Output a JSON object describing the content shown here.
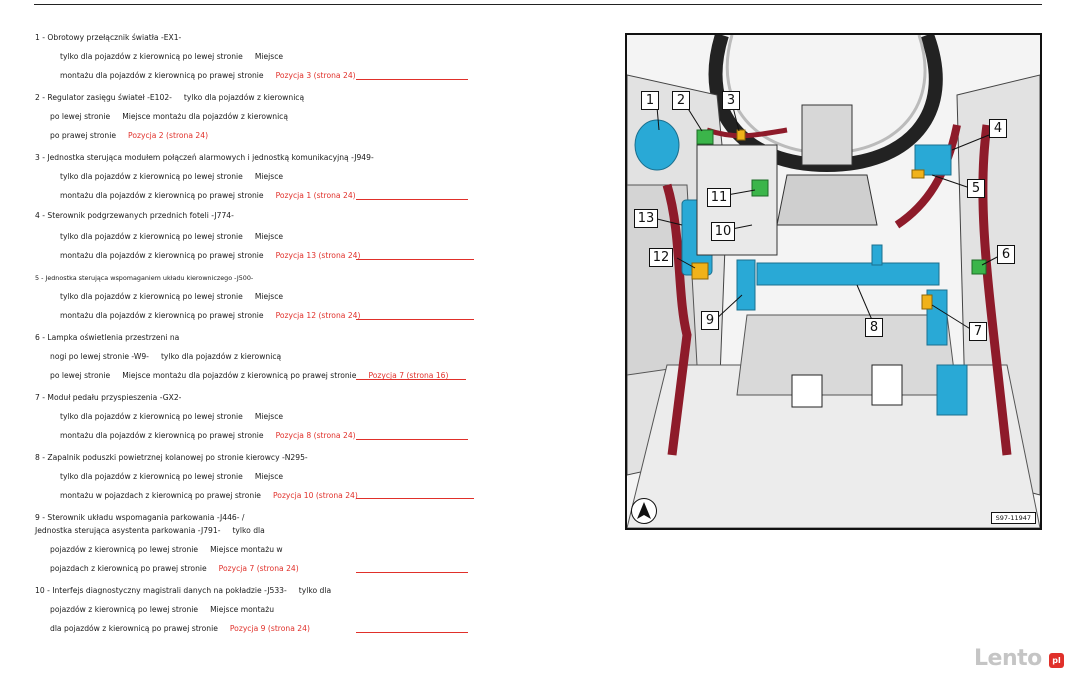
{
  "items": [
    {
      "lines": [
        {
          "parts": [
            {
              "t": "1 - Obrotowy przełącznik światła -EX1-"
            }
          ]
        },
        {
          "parts": [
            {
              "t": "tylko dla pojazdów z kierownicą po lewej stronie"
            },
            {
              "t": "Miejsce"
            }
          ]
        },
        {
          "parts": [
            {
              "t": "montażu dla pojazdów z kierownicą po prawej stronie"
            },
            {
              "t": "Pozycja 3 (strona 24)",
              "red": true
            }
          ]
        }
      ]
    },
    {
      "lines": [
        {
          "parts": [
            {
              "t": "2 - Regulator zasięgu świateł -E102-"
            },
            {
              "t": "tylko dla pojazdów z kierownicą"
            }
          ]
        },
        {
          "parts": [
            {
              "t": "po lewej stronie"
            },
            {
              "t": "Miejsce montażu dla pojazdów z kierownicą"
            }
          ]
        },
        {
          "parts": [
            {
              "t": "po prawej stronie"
            },
            {
              "t": "Pozycja 2 (strona 24)",
              "red": true
            }
          ]
        }
      ]
    },
    {
      "lines": [
        {
          "parts": [
            {
              "t": "3 - Jednostka sterująca modułem połączeń alarmowych i jednostką komunikacyjną -J949-"
            }
          ]
        },
        {
          "parts": [
            {
              "t": "tylko dla pojazdów z kierownicą po lewej stronie"
            },
            {
              "t": "Miejsce"
            }
          ]
        },
        {
          "parts": [
            {
              "t": "montażu dla pojazdów z kierownicą po prawej stronie"
            },
            {
              "t": "Pozycja 1 (strona 24)",
              "red": true
            }
          ]
        }
      ]
    },
    {
      "lines": [
        {
          "parts": [
            {
              "t": "4 - Sterownik podgrzewanych przednich foteli -J774-"
            }
          ]
        },
        {
          "parts": [
            {
              "t": "tylko dla pojazdów z kierownicą po lewej stronie"
            },
            {
              "t": "Miejsce"
            }
          ]
        },
        {
          "parts": [
            {
              "t": "montażu dla pojazdów z kierownicą po prawej stronie"
            },
            {
              "t": "Pozycja 13 (strona 24)",
              "red": true
            }
          ]
        }
      ]
    },
    {
      "lines": [
        {
          "parts": [
            {
              "t": "5 - Jednostka sterująca wspomaganiem układu kierowniczego -J500-"
            }
          ]
        },
        {
          "parts": [
            {
              "t": "tylko dla pojazdów z kierownicą po lewej stronie"
            },
            {
              "t": "Miejsce"
            }
          ]
        },
        {
          "parts": [
            {
              "t": "montażu dla pojazdów z kierownicą po prawej stronie"
            },
            {
              "t": "Pozycja 12 (strona 24)",
              "red": true
            }
          ]
        }
      ]
    },
    {
      "lines": [
        {
          "parts": [
            {
              "t": "6 - Lampka oświetlenia przestrzeni na"
            }
          ]
        },
        {
          "parts": [
            {
              "t": "nogi po lewej stronie -W9-"
            },
            {
              "t": "tylko dla pojazdów z kierownicą"
            }
          ]
        },
        {
          "parts": [
            {
              "t": "po lewej stronie"
            },
            {
              "t": "Miejsce montażu dla pojazdów z kierownicą po prawej stronie"
            },
            {
              "t": "Pozycja 7 (strona 16)",
              "red": true
            }
          ]
        }
      ]
    },
    {
      "lines": [
        {
          "parts": [
            {
              "t": "7 - Moduł pedału przyspieszenia -GX2-"
            }
          ]
        },
        {
          "parts": [
            {
              "t": "tylko dla pojazdów z kierownicą po lewej stronie"
            },
            {
              "t": "Miejsce"
            }
          ]
        },
        {
          "parts": [
            {
              "t": "montażu dla pojazdów z kierownicą po prawej stronie"
            },
            {
              "t": "Pozycja 8 (strona 24)",
              "red": true
            }
          ]
        }
      ]
    },
    {
      "lines": [
        {
          "parts": [
            {
              "t": "8 - Zapalnik poduszki powietrznej kolanowej po stronie kierowcy -N295-"
            }
          ]
        },
        {
          "parts": [
            {
              "t": "tylko dla pojazdów z kierownicą po lewej stronie"
            },
            {
              "t": "Miejsce"
            }
          ]
        },
        {
          "parts": [
            {
              "t": "montażu w pojazdach z kierownicą po prawej stronie"
            },
            {
              "t": "Pozycja 10 (strona 24)",
              "red": true
            }
          ]
        }
      ]
    },
    {
      "lines": [
        {
          "parts": [
            {
              "t": "9 - Sterownik układu wspomagania parkowania -J446- /"
            }
          ]
        },
        {
          "parts": [
            {
              "t": "Jednostka sterująca asystenta parkowania -J791-"
            },
            {
              "t": "tylko dla"
            }
          ]
        },
        {
          "parts": [
            {
              "t": "pojazdów z kierownicą po lewej stronie"
            },
            {
              "t": "Miejsce montażu w"
            }
          ]
        },
        {
          "parts": [
            {
              "t": "pojazdach z kierownicą po prawej stronie"
            },
            {
              "t": "Pozycja 7 (strona 24)",
              "red": true
            }
          ]
        }
      ]
    },
    {
      "lines": [
        {
          "parts": [
            {
              "t": "10 - Interfejs diagnostyczny magistrali danych na pokładzie -J533-"
            },
            {
              "t": "tylko dla"
            }
          ]
        },
        {
          "parts": [
            {
              "t": "pojazdów z kierownicą po lewej stronie"
            },
            {
              "t": "Miejsce montażu"
            }
          ]
        },
        {
          "parts": [
            {
              "t": "dla pojazdów z kierownicą po prawej stronie"
            },
            {
              "t": "Pozycja 9 (strona 24)",
              "red": true
            }
          ]
        }
      ]
    }
  ],
  "figure": {
    "code": "S97-11947",
    "callouts": [
      "1",
      "2",
      "3",
      "4",
      "5",
      "6",
      "7",
      "8",
      "9",
      "10",
      "11",
      "12",
      "13"
    ]
  },
  "watermark": {
    "text": "Lento",
    "suffix": "pl"
  },
  "colors": {
    "accent_red": "#e0302a",
    "component_blue": "#29a9d6",
    "harness_red": "#8e1b2a",
    "connector_green": "#3bb54a",
    "connector_yellow": "#f0b21a"
  }
}
